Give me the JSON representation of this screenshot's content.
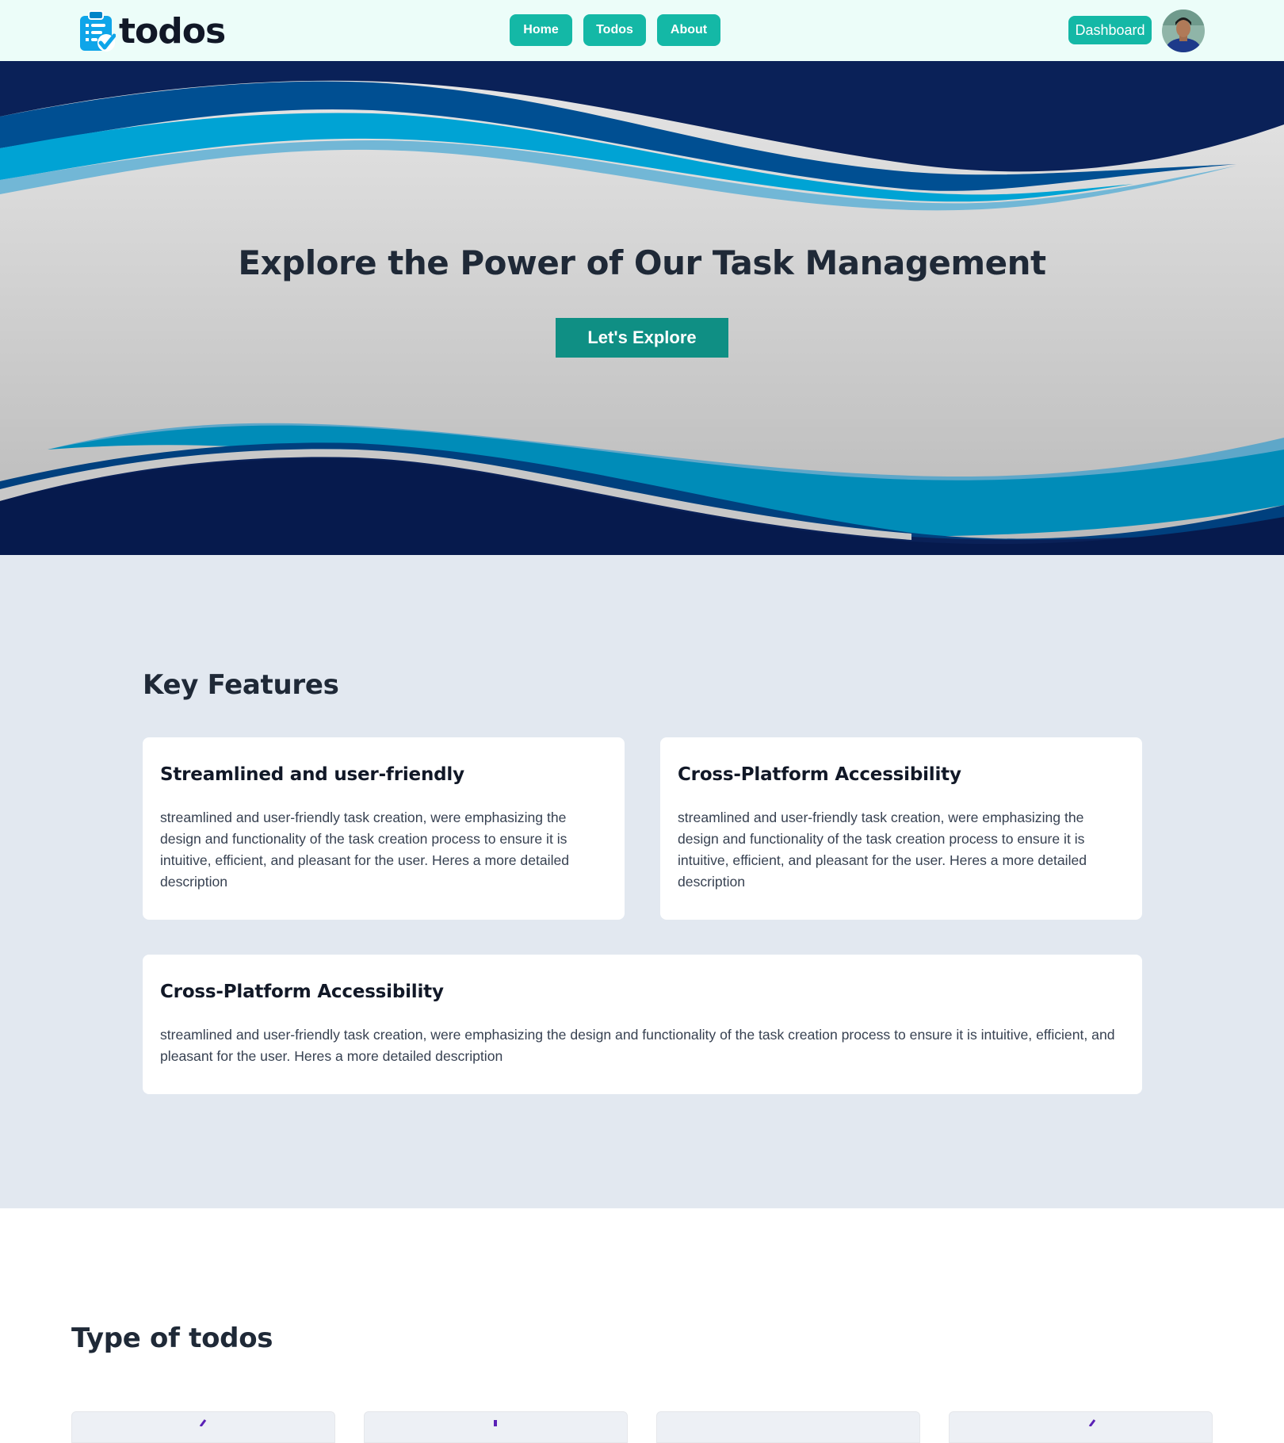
{
  "nav": {
    "logo_text": "todos",
    "links": [
      "Home",
      "Todos",
      "About"
    ],
    "dashboard_label": "Dashboard"
  },
  "hero": {
    "title": "Explore the Power of Our Task Management",
    "cta_label": "Let's Explore"
  },
  "features": {
    "title": "Key Features",
    "cards": [
      {
        "title": "Streamlined and user-friendly",
        "body": "streamlined and user-friendly task creation, were emphasizing the design and functionality of the task creation process to ensure it is intuitive, efficient, and pleasant for the user. Heres a more detailed description"
      },
      {
        "title": "Cross-Platform Accessibility",
        "body": "streamlined and user-friendly task creation, were emphasizing the design and functionality of the task creation process to ensure it is intuitive, efficient, and pleasant for the user. Heres a more detailed description"
      },
      {
        "title": "Cross-Platform Accessibility",
        "body": "streamlined and user-friendly task creation, were emphasizing the design and functionality of the task creation process to ensure it is intuitive, efficient, and pleasant for the user. Heres a more detailed description"
      }
    ]
  },
  "types": {
    "title": "Type of todos"
  },
  "colors": {
    "accent": "#14b8a6",
    "cta": "#0f8f84",
    "navbar_bg": "#ecfdf9",
    "hero_navy": "#0a2158",
    "features_bg": "#e2e8f0"
  },
  "icons": [
    "clipboard-check-icon",
    "user-avatar"
  ]
}
